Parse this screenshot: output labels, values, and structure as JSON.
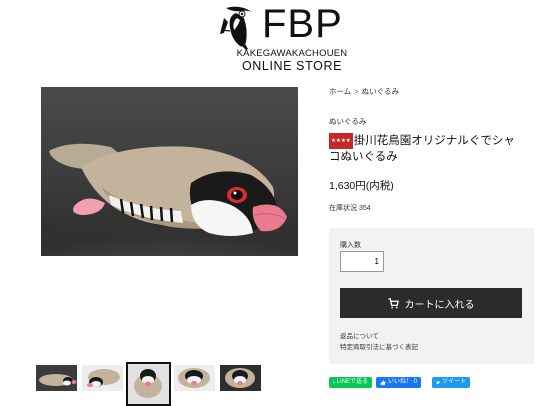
{
  "header": {
    "logo_title": "FBP",
    "logo_subtitle": "KAKEGAWAKACHOUEN",
    "logo_store": "ONLINE STORE"
  },
  "breadcrumb": {
    "home": "ホーム",
    "separator": ">",
    "current": "ぬいぐるみ"
  },
  "product": {
    "category": "ぬいぐるみ",
    "badge": "★★★★",
    "title": "掛川花鳥園オリジナルぐでシャコぬいぐるみ",
    "price": "1,630円(内税)",
    "stock": "在庫状況 354"
  },
  "purchase": {
    "qty_label": "購入数",
    "qty_value": "1",
    "cart_button": "カートに入れる",
    "returns_link": "返品について",
    "law_link": "特定商取引法に基づく表記"
  },
  "share": {
    "line": "LINEで送る",
    "facebook": "いいね！ 0",
    "twitter": "ツイート"
  },
  "colors": {
    "accent": "#2b2b2b",
    "line": "#06c755",
    "facebook": "#1877f2",
    "twitter": "#1d9bf0"
  }
}
